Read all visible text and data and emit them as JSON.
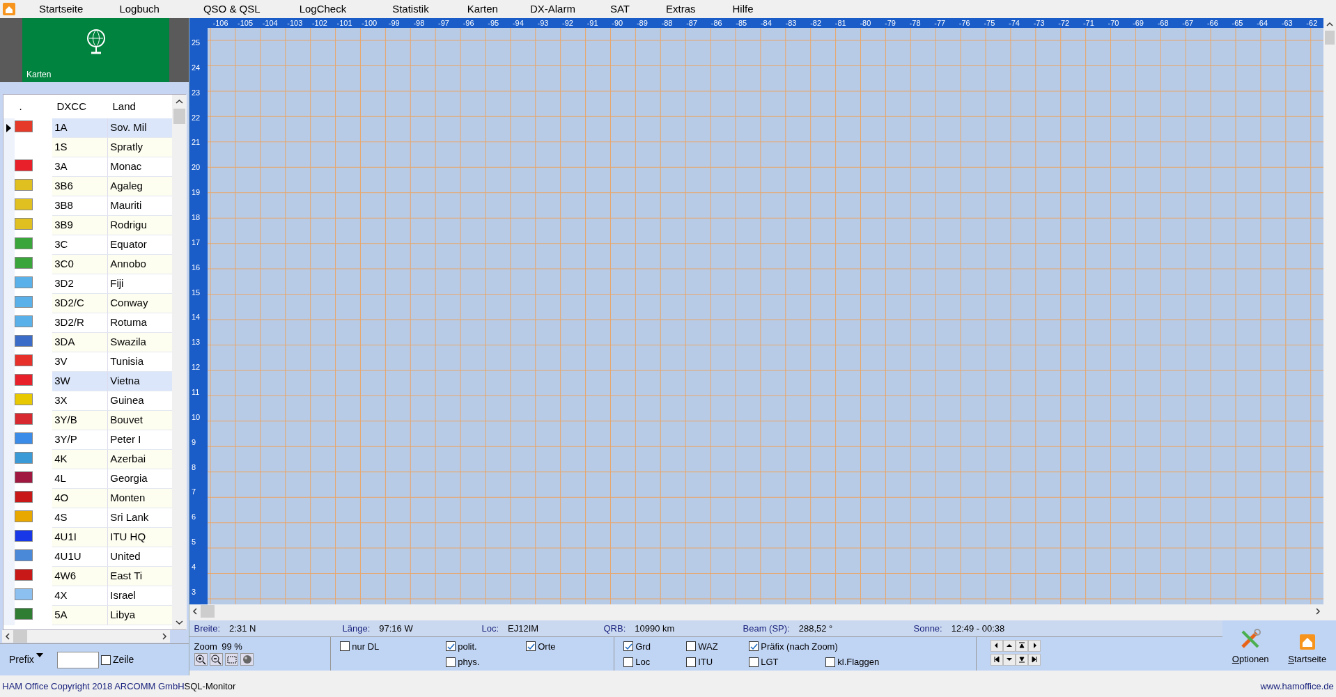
{
  "menu": {
    "items": [
      "Startseite",
      "Logbuch",
      "QSO & QSL",
      "LogCheck",
      "Statistik",
      "Karten",
      "DX-Alarm",
      "SAT",
      "Extras",
      "Hilfe"
    ]
  },
  "tile": {
    "label": "Karten"
  },
  "table": {
    "columns": [
      ".",
      "DXCC",
      "Land"
    ],
    "rows": [
      {
        "prefix": "1A",
        "land": "Sov. Mil",
        "color": "#e53a2a",
        "selected": true,
        "current": true
      },
      {
        "prefix": "1S",
        "land": "Spratly",
        "selected": false,
        "current": false
      },
      {
        "prefix": "3A",
        "land": "Monac",
        "color": "#e8202a",
        "selected": false,
        "current": false
      },
      {
        "prefix": "3B6",
        "land": "Agaleg",
        "color": "#e0c020",
        "selected": false,
        "current": false
      },
      {
        "prefix": "3B8",
        "land": "Mauriti",
        "color": "#e0c020",
        "selected": false,
        "current": false
      },
      {
        "prefix": "3B9",
        "land": "Rodrigu",
        "color": "#e0c020",
        "selected": false,
        "current": false
      },
      {
        "prefix": "3C",
        "land": "Equator",
        "color": "#3aa53a",
        "selected": false,
        "current": false
      },
      {
        "prefix": "3C0",
        "land": "Annobo",
        "color": "#3aa53a",
        "selected": false,
        "current": false
      },
      {
        "prefix": "3D2",
        "land": "Fiji",
        "color": "#5ab0e8",
        "selected": false,
        "current": false
      },
      {
        "prefix": "3D2/C",
        "land": "Conway",
        "color": "#5ab0e8",
        "selected": false,
        "current": false
      },
      {
        "prefix": "3D2/R",
        "land": "Rotuma",
        "color": "#5ab0e8",
        "selected": false,
        "current": false
      },
      {
        "prefix": "3DA",
        "land": "Swazila",
        "color": "#3a6cc8",
        "selected": false,
        "current": false
      },
      {
        "prefix": "3V",
        "land": "Tunisia",
        "color": "#e8302a",
        "selected": false,
        "current": false
      },
      {
        "prefix": "3W",
        "land": "Vietna",
        "color": "#e8202a",
        "selected": true,
        "current": false
      },
      {
        "prefix": "3X",
        "land": "Guinea",
        "color": "#e8c800",
        "selected": false,
        "current": false
      },
      {
        "prefix": "3Y/B",
        "land": "Bouvet",
        "color": "#d82830",
        "selected": false,
        "current": false
      },
      {
        "prefix": "3Y/P",
        "land": "Peter I",
        "color": "#3a8ce8",
        "selected": false,
        "current": false
      },
      {
        "prefix": "4K",
        "land": "Azerbai",
        "color": "#3a9ad8",
        "selected": false,
        "current": false
      },
      {
        "prefix": "4L",
        "land": "Georgia",
        "color": "#a01840",
        "selected": false,
        "current": false
      },
      {
        "prefix": "4O",
        "land": "Monten",
        "color": "#c81818",
        "selected": false,
        "current": false
      },
      {
        "prefix": "4S",
        "land": "Sri Lank",
        "color": "#e8a800",
        "selected": false,
        "current": false
      },
      {
        "prefix": "4U1I",
        "land": "ITU HQ",
        "color": "#1838e8",
        "selected": false,
        "current": false
      },
      {
        "prefix": "4U1U",
        "land": "United",
        "color": "#4a88d8",
        "selected": false,
        "current": false
      },
      {
        "prefix": "4W6",
        "land": "East Ti",
        "color": "#c81818",
        "selected": false,
        "current": false
      },
      {
        "prefix": "4X",
        "land": "Israel",
        "color": "#8cc0f0",
        "selected": false,
        "current": false
      },
      {
        "prefix": "5A",
        "land": "Libya",
        "color": "#2e7d32",
        "selected": false,
        "current": false
      }
    ]
  },
  "map": {
    "longitudes": [
      "-106",
      "-105",
      "-104",
      "-103",
      "-102",
      "-101",
      "-100",
      "-99",
      "-98",
      "-97",
      "-96",
      "-95",
      "-94",
      "-93",
      "-92",
      "-91",
      "-90",
      "-89",
      "-88",
      "-87",
      "-86",
      "-85",
      "-84",
      "-83",
      "-82",
      "-81",
      "-80",
      "-79",
      "-78",
      "-77",
      "-76",
      "-75",
      "-74",
      "-73",
      "-72",
      "-71",
      "-70",
      "-69",
      "-68",
      "-67",
      "-66",
      "-65",
      "-64",
      "-63",
      "-62"
    ],
    "latitudes": [
      "25",
      "24",
      "23",
      "22",
      "21",
      "20",
      "19",
      "18",
      "17",
      "16",
      "15",
      "14",
      "13",
      "12",
      "11",
      "10",
      "9",
      "8",
      "7",
      "6",
      "5",
      "4",
      "3"
    ]
  },
  "prefix_filter": {
    "label": "Prefix",
    "zeile": {
      "label": "Zeile",
      "checked": false
    }
  },
  "info_bar": [
    {
      "label": "Breite:",
      "value": "2:31 N"
    },
    {
      "label": "Länge:",
      "value": "97:16 W"
    },
    {
      "label": "Loc:",
      "value": "EJ12IM"
    },
    {
      "label": "QRB:",
      "value": "10990 km"
    },
    {
      "label": "Beam (SP):",
      "value": "288,52 °"
    },
    {
      "label": "Sonne:",
      "value": "12:49 - 00:38"
    }
  ],
  "zoom": {
    "label": "Zoom",
    "value": "99 %"
  },
  "layer_options": {
    "columns": [
      [
        {
          "label": "nur DL",
          "checked": false
        }
      ],
      [
        {
          "label": "polit.",
          "checked": true
        },
        {
          "label": "phys.",
          "checked": false
        }
      ],
      [
        {
          "label": "Orte",
          "checked": true
        }
      ]
    ]
  },
  "grid_options": {
    "rows": [
      [
        {
          "label": "Grd",
          "checked": true
        },
        {
          "label": "WAZ",
          "checked": false
        },
        {
          "label": "Präfix (nach Zoom)",
          "checked": true
        }
      ],
      [
        {
          "label": "Loc",
          "checked": false
        },
        {
          "label": "ITU",
          "checked": false
        },
        {
          "label": "LGT",
          "checked": false
        },
        {
          "label": "kl.Flaggen",
          "checked": false
        }
      ]
    ]
  },
  "actions": [
    {
      "label": "Optionen",
      "kind": "options"
    },
    {
      "label": "Startseite",
      "kind": "home"
    }
  ],
  "footer": {
    "copyright": "HAM Office Copyright 2018 ARCOMM GmbH",
    "monitor": "SQL-Monitor",
    "website": "www.hamoffice.de"
  }
}
